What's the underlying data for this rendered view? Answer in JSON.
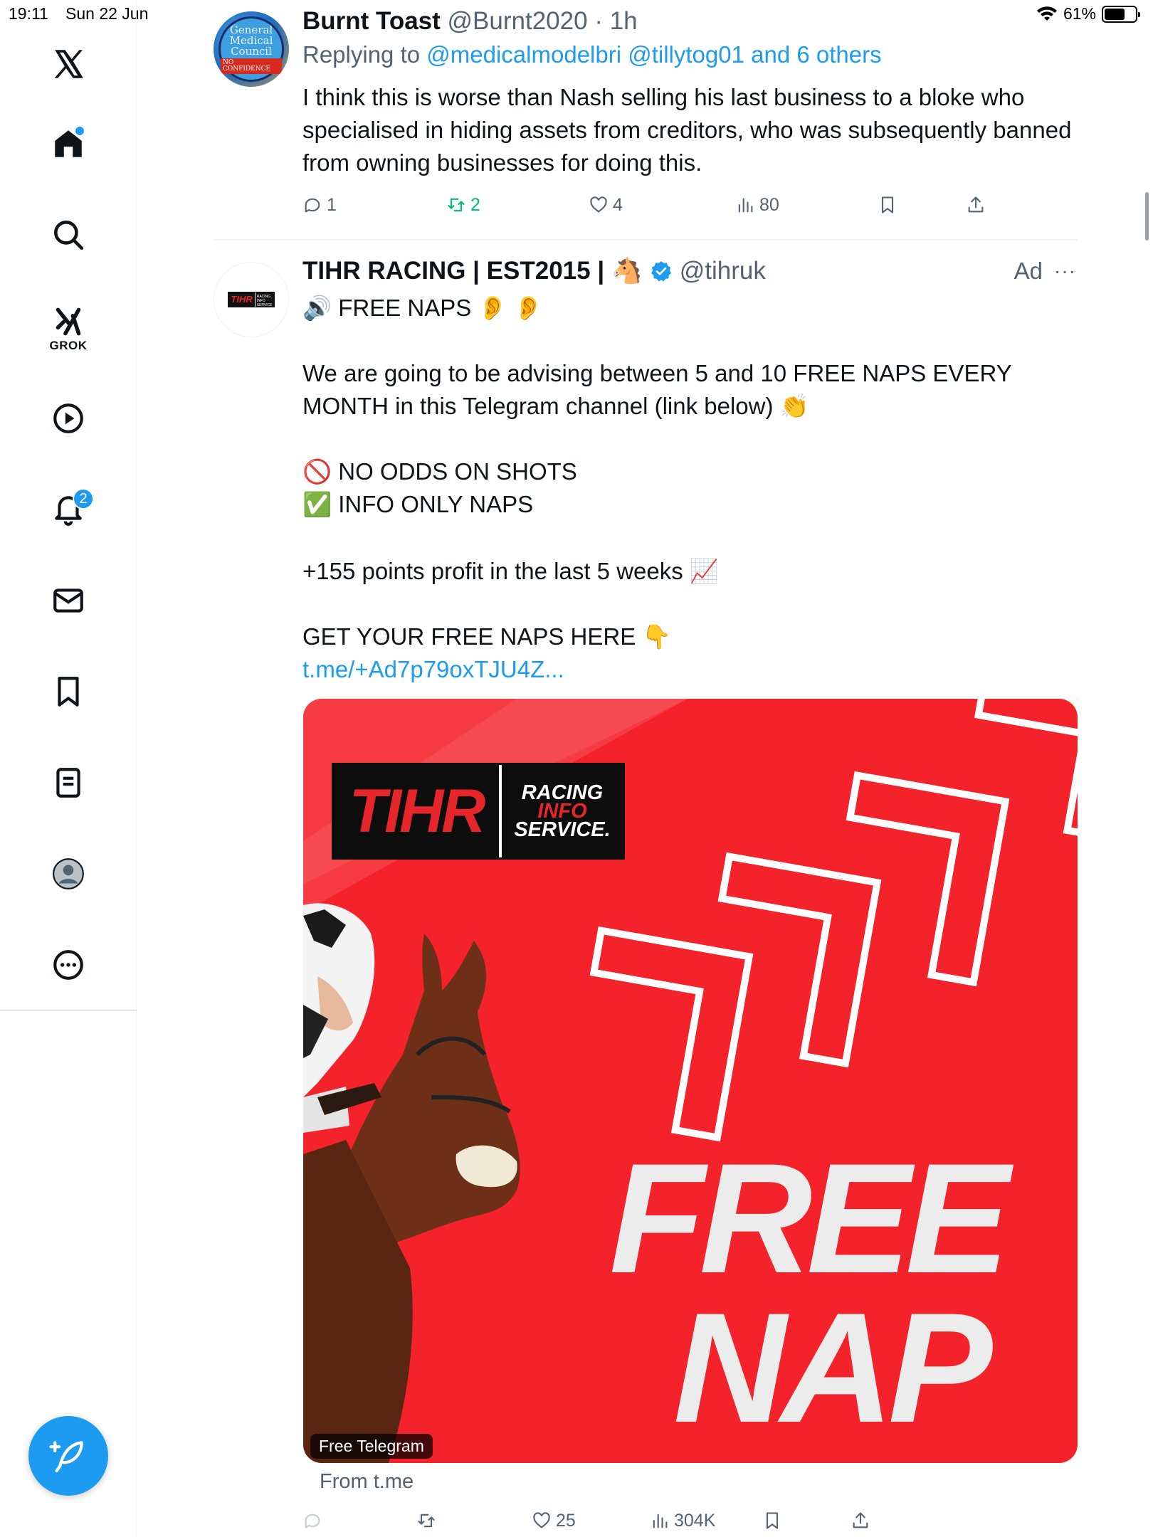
{
  "status_bar": {
    "time": "19:11",
    "date": "Sun 22 Jun",
    "battery": "61%",
    "battery_level": 0.61
  },
  "sidebar": {
    "items": [
      {
        "name": "x-logo-icon"
      },
      {
        "name": "home-icon",
        "has_dot": true
      },
      {
        "name": "search-icon"
      },
      {
        "name": "grok-icon",
        "label": "GROK"
      },
      {
        "name": "video-icon"
      },
      {
        "name": "notifications-icon",
        "badge": "2"
      },
      {
        "name": "messages-icon"
      },
      {
        "name": "bookmarks-icon"
      },
      {
        "name": "lists-icon"
      },
      {
        "name": "profile-icon"
      },
      {
        "name": "more-icon"
      }
    ],
    "compose": {
      "name": "compose-icon"
    }
  },
  "tweet1": {
    "avatar_text": [
      "General",
      "Medical",
      "Council",
      "NO CONFIDENCE"
    ],
    "name": "Burnt Toast",
    "handle": "@Burnt2020",
    "time": "· 1h",
    "reply_prefix": "Replying to",
    "reply_mentions": "@medicalmodelbri @tillytog01 and 6 others",
    "text": "I think this is worse than Nash selling his last business to a bloke who specialised in hiding assets from creditors, who was subsequently banned from owning businesses for doing this.",
    "replies": "1",
    "reposts": "2",
    "likes": "4",
    "views": "80"
  },
  "tweet2": {
    "avatar_text": {
      "main": "TIHR",
      "sub": [
        "RACING",
        "INFO",
        "SERVICE"
      ]
    },
    "name": "TIHR RACING | EST2015 |",
    "name_emoji": "🐴",
    "handle": "@tihruk",
    "ad_label": "Ad",
    "more": "···",
    "line1": "🔊 FREE NAPS 👂 👂",
    "line2": "We are going to be advising between 5 and 10 FREE NAPS EVERY MONTH in this Telegram channel (link below) 👏",
    "line3": "🚫 NO ODDS ON SHOTS",
    "line4": "✅ INFO ONLY NAPS",
    "line5": "+155 points profit in the last 5 weeks 📈",
    "line6": "GET YOUR FREE NAPS HERE 👇",
    "link": "t.me/+Ad7p79oxTJU4Z...",
    "card": {
      "logo_main": "TIHR",
      "logo_sub1": "RACING",
      "logo_sub2": "INFO",
      "logo_sub3": "SERVICE.",
      "headline1": "FREE",
      "headline2": "NAP",
      "badge": "Free Telegram"
    },
    "from": "From t.me",
    "reposts": "",
    "likes": "25",
    "views": "304K"
  },
  "colors": {
    "accent": "#1d9bf0",
    "repost_active": "#00ba7c",
    "muted": "#536471",
    "card_red": "#f4222a"
  }
}
